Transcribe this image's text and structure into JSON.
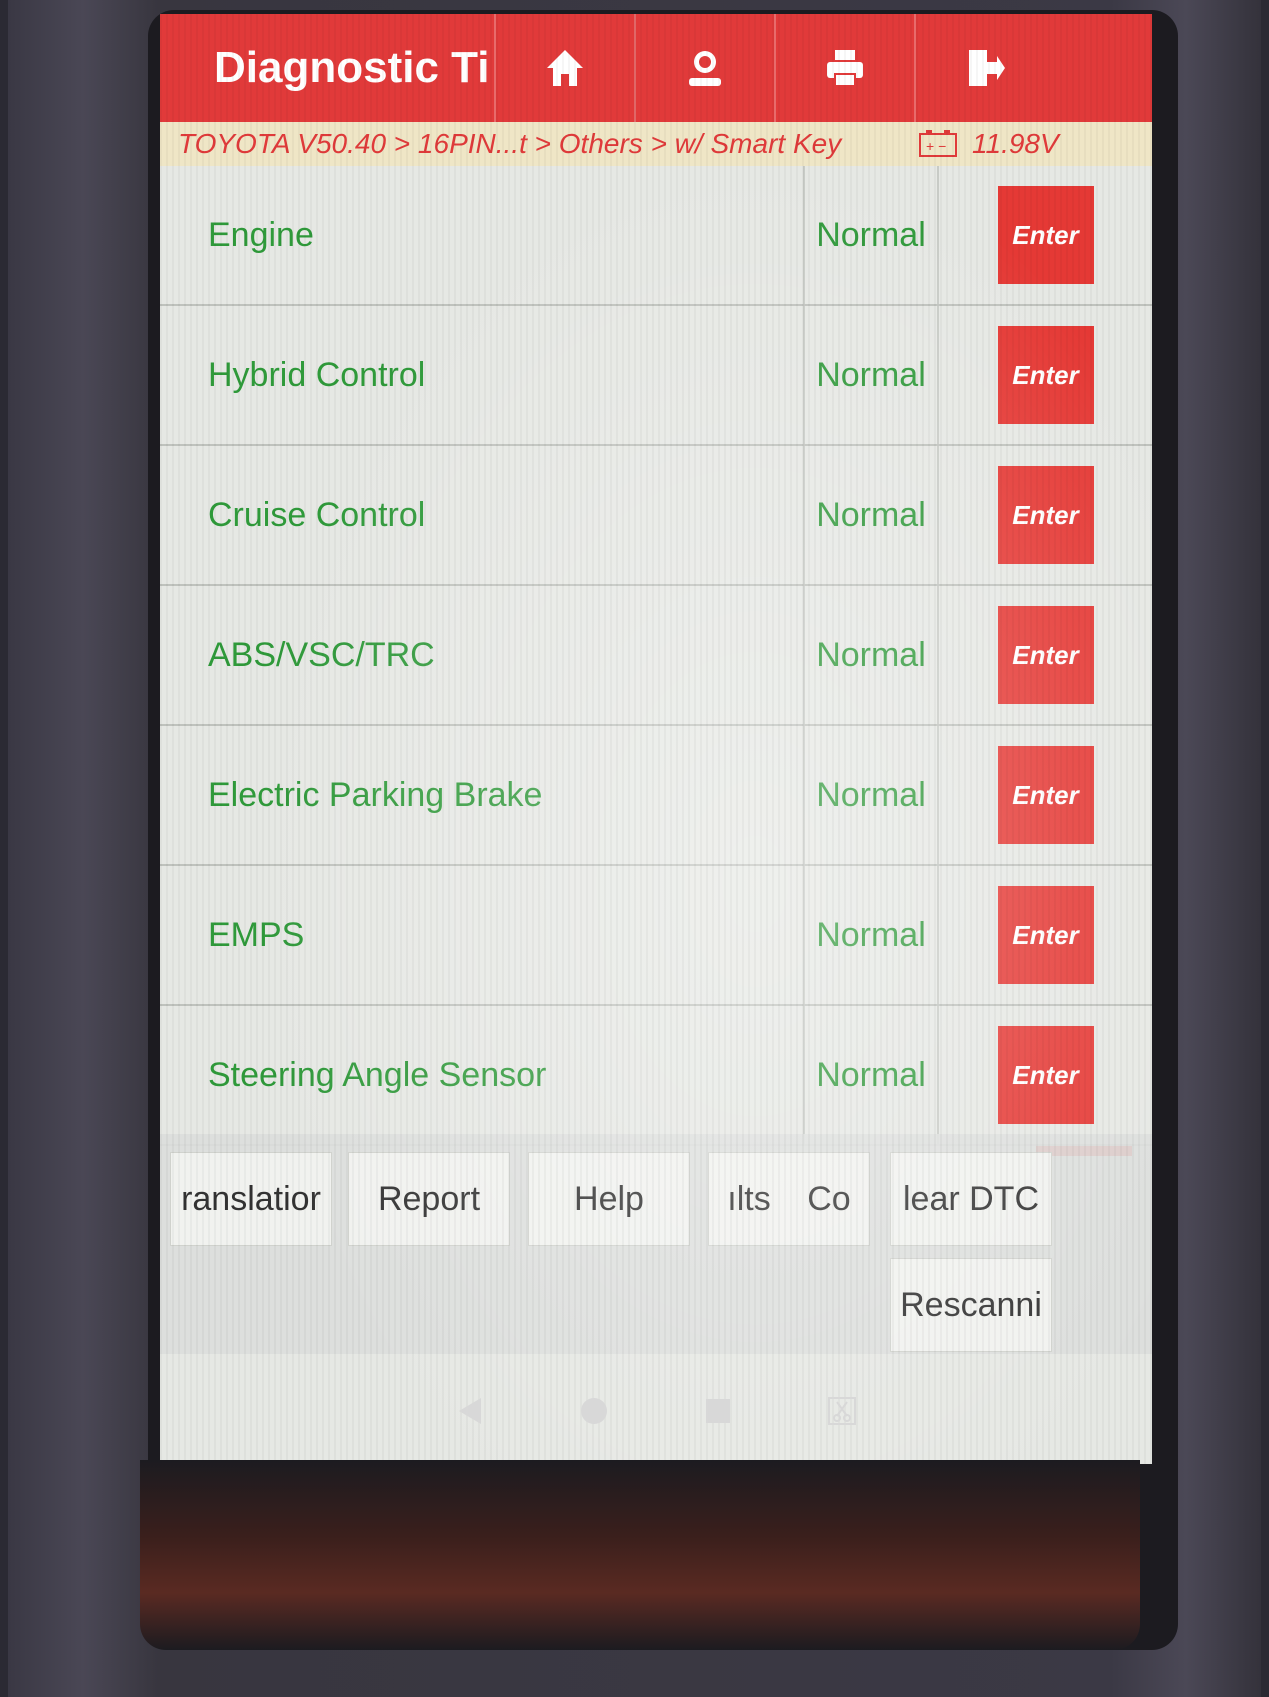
{
  "header": {
    "title": "Diagnostic Ti",
    "icons": [
      "home-icon",
      "support-person-icon",
      "print-icon",
      "exit-icon"
    ],
    "accent_color": "#e13a3a"
  },
  "breadcrumb": {
    "path": "TOYOTA V50.40 > 16PIN...t > Others > w/ Smart Key",
    "battery_icon": "battery-icon",
    "voltage": "11.98V"
  },
  "systems": [
    {
      "name": "Engine",
      "status": "Normal",
      "action": "Enter"
    },
    {
      "name": "Hybrid Control",
      "status": "Normal",
      "action": "Enter"
    },
    {
      "name": "Cruise Control",
      "status": "Normal",
      "action": "Enter"
    },
    {
      "name": "ABS/VSC/TRC",
      "status": "Normal",
      "action": "Enter"
    },
    {
      "name": "Electric Parking Brake",
      "status": "Normal",
      "action": "Enter"
    },
    {
      "name": "EMPS",
      "status": "Normal",
      "action": "Enter"
    },
    {
      "name": "Steering Angle Sensor",
      "status": "Normal",
      "action": "Enter"
    }
  ],
  "footer": {
    "translation": "ranslatior",
    "report": "Report",
    "help": "Help",
    "results": "ılts",
    "co": "Co",
    "clear_dtc": "lear DTC",
    "rescanning": "Rescanni"
  },
  "colors": {
    "status_text": "#2f9a3a",
    "enter_button": "#e53935"
  },
  "nav": [
    "back-icon",
    "home-dot-icon",
    "recents-icon",
    "screenshot-icon"
  ]
}
